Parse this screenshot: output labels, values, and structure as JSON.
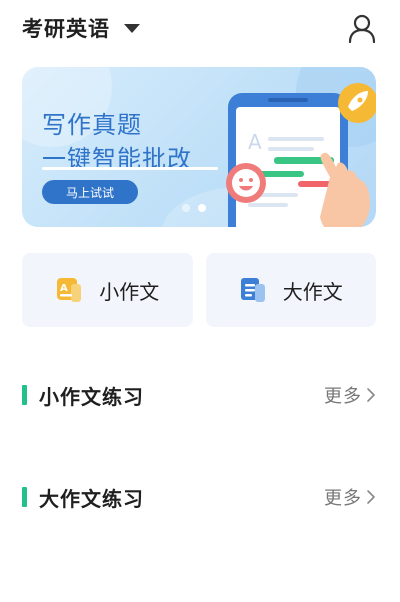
{
  "header": {
    "title": "考研英语",
    "dropdown_icon": "caret-down-icon",
    "user_icon": "user-icon"
  },
  "banner": {
    "line1": "写作真题",
    "line2": "一键智能批改",
    "button_label": "马上试试",
    "carousel_active_index": 1,
    "carousel_count": 2,
    "accent_color": "#2f74c9"
  },
  "cards": [
    {
      "label": "小作文",
      "icon": "small-essay-icon"
    },
    {
      "label": "大作文",
      "icon": "large-essay-icon"
    }
  ],
  "sections": [
    {
      "title": "小作文练习",
      "more_label": "更多"
    },
    {
      "title": "大作文练习",
      "more_label": "更多"
    }
  ],
  "colors": {
    "section_bar": "#23c08a",
    "card_bg": "#f2f6fc"
  }
}
